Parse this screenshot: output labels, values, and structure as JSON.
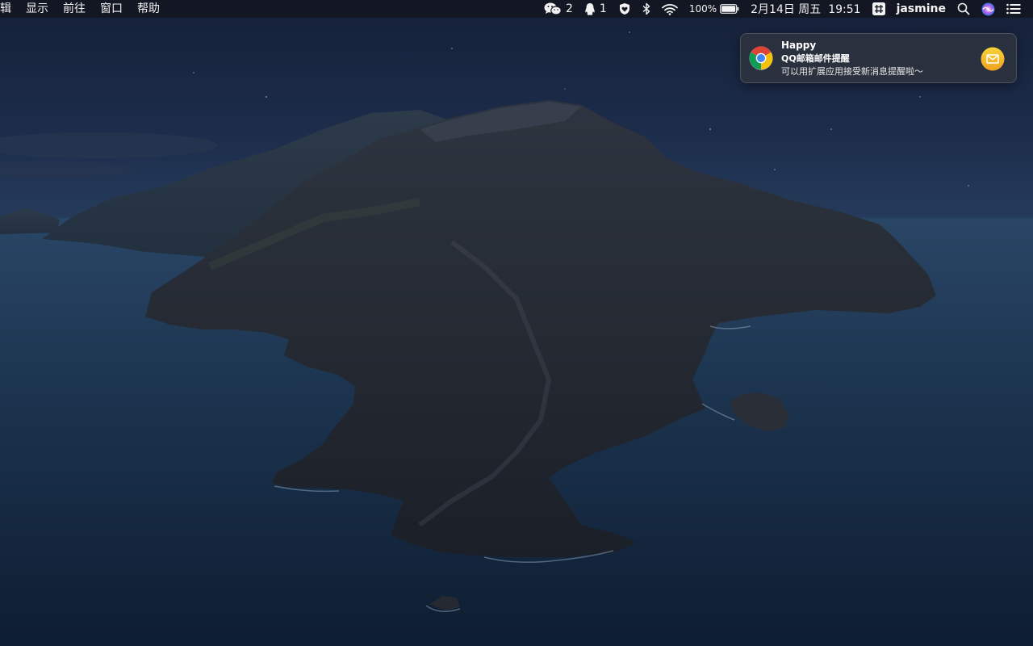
{
  "menubar": {
    "menus": [
      "辑",
      "显示",
      "前往",
      "窗口",
      "帮助"
    ],
    "status": {
      "wechat": {
        "icon": "wechat-icon",
        "count": "2"
      },
      "qq": {
        "icon": "qq-penguin-icon",
        "count": "1"
      },
      "shield": {
        "icon": "shield-heart-icon"
      },
      "bluetooth": {
        "icon": "bluetooth-icon"
      },
      "wifi": {
        "icon": "wifi-icon"
      },
      "battery": {
        "icon": "battery-icon",
        "percent": "100%",
        "level": 1.0
      },
      "datetime": "2月14日 周五  19:51",
      "input_method": {
        "icon": "input-method-grid-icon"
      },
      "user": "jasmine",
      "spotlight": {
        "icon": "search-icon"
      },
      "siri": {
        "icon": "siri-icon"
      },
      "notification_center": {
        "icon": "notification-center-list-icon"
      }
    }
  },
  "notification": {
    "app_icon": "chrome-icon",
    "title": "Happy",
    "subtitle": "QQ邮箱邮件提醒",
    "body": "可以用扩展应用接受新消息提醒啦～",
    "attachment_icon": "mail-envelope-icon"
  },
  "wallpaper": {
    "description_icon": "catalina-island-night-wallpaper"
  },
  "colors": {
    "menubar_bg": "#12161f",
    "notification_bg": "#2c323e",
    "mail_icon_bg": "#f5c431"
  }
}
